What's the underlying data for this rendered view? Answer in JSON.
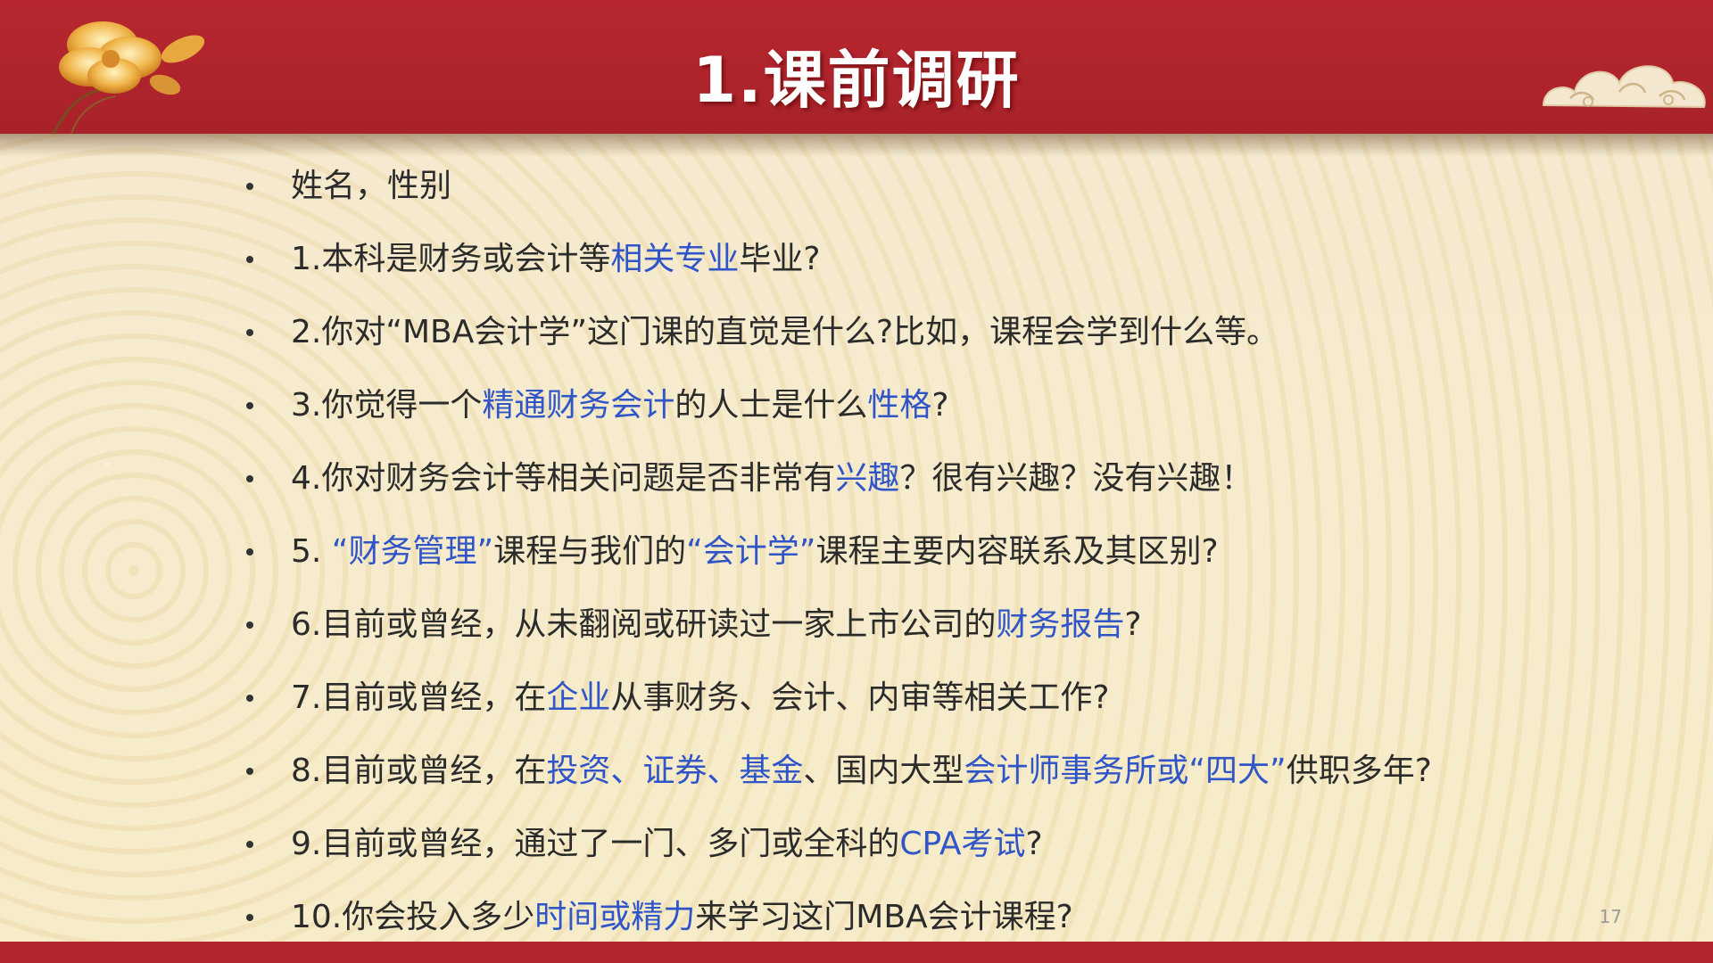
{
  "slide": {
    "title": "1.课前调研",
    "page_number": "17",
    "colors": {
      "header": "#b8272f",
      "highlight": "#2f55c8",
      "text": "#2b2b2b",
      "background": "#f6ecc9"
    },
    "decor": {
      "left": "peony-flower-icon",
      "right": "auspicious-cloud-icon"
    }
  },
  "items": [
    {
      "parts": [
        {
          "t": "姓名，性别",
          "hl": false
        }
      ]
    },
    {
      "parts": [
        {
          "t": "1.本科是财务或会计等",
          "hl": false
        },
        {
          "t": "相关专业",
          "hl": true
        },
        {
          "t": "毕业?",
          "hl": false
        }
      ]
    },
    {
      "parts": [
        {
          "t": "2.你对“MBA会计学”这门课的直觉是什么?比如，课程会学到什么等。",
          "hl": false
        }
      ]
    },
    {
      "parts": [
        {
          "t": "3.你觉得一个",
          "hl": false
        },
        {
          "t": "精通财务会计",
          "hl": true
        },
        {
          "t": "的人士是什么",
          "hl": false
        },
        {
          "t": "性格",
          "hl": true
        },
        {
          "t": "?",
          "hl": false
        }
      ]
    },
    {
      "parts": [
        {
          "t": "4.你对财务会计等相关问题是否非常有",
          "hl": false
        },
        {
          "t": "兴趣",
          "hl": true
        },
        {
          "t": "？很有兴趣？没有兴趣！",
          "hl": false
        }
      ]
    },
    {
      "parts": [
        {
          "t": "5. ",
          "hl": false
        },
        {
          "t": "“财务管理”",
          "hl": true
        },
        {
          "t": "课程与我们的",
          "hl": false
        },
        {
          "t": "“会计学”",
          "hl": true
        },
        {
          "t": "课程主要内容联系及其区别?",
          "hl": false
        }
      ]
    },
    {
      "parts": [
        {
          "t": "6.目前或曾经，从未翻阅或研读过一家上市公司的",
          "hl": false
        },
        {
          "t": "财务报告",
          "hl": true
        },
        {
          "t": "?",
          "hl": false
        }
      ]
    },
    {
      "parts": [
        {
          "t": "7.目前或曾经，在",
          "hl": false
        },
        {
          "t": "企业",
          "hl": true
        },
        {
          "t": "从事财务、会计、内审等相关工作?",
          "hl": false
        }
      ]
    },
    {
      "parts": [
        {
          "t": "8.目前或曾经，在",
          "hl": false
        },
        {
          "t": "投资、证券、基金",
          "hl": true
        },
        {
          "t": "、国内大型",
          "hl": false
        },
        {
          "t": "会计师事务所或“四大”",
          "hl": true
        },
        {
          "t": "供职多年?",
          "hl": false
        }
      ]
    },
    {
      "parts": [
        {
          "t": "9.目前或曾经，通过了一门、多门或全科的",
          "hl": false
        },
        {
          "t": "CPA考试",
          "hl": true
        },
        {
          "t": "?",
          "hl": false
        }
      ]
    },
    {
      "parts": [
        {
          "t": "10.你会投入多少",
          "hl": false
        },
        {
          "t": "时间或精力",
          "hl": true
        },
        {
          "t": "来学习这门MBA会计课程?",
          "hl": false
        }
      ]
    }
  ]
}
